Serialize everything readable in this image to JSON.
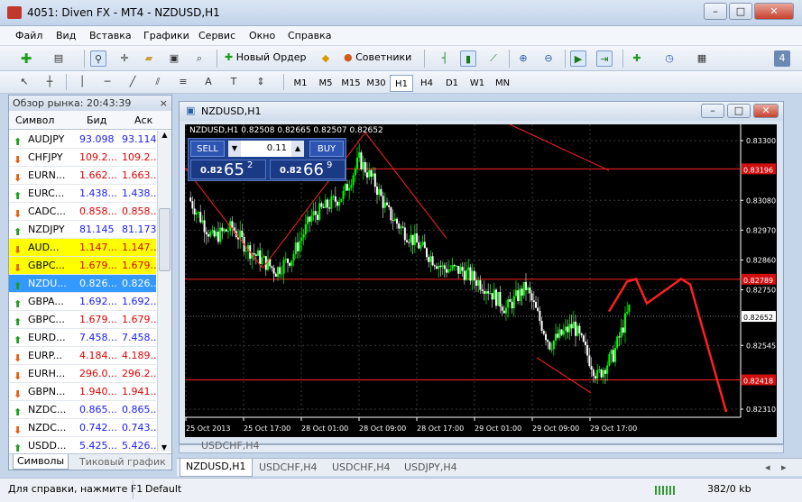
{
  "window": {
    "title": "4051: Diven FX - MT4 - NZDUSD,H1"
  },
  "menu": [
    "Файл",
    "Вид",
    "Вставка",
    "Графики",
    "Сервис",
    "Окно",
    "Справка"
  ],
  "toolbar": {
    "new_order": "Новый Ордер",
    "experts": "Советники"
  },
  "timeframes": [
    "M1",
    "M5",
    "M15",
    "M30",
    "H1",
    "H4",
    "D1",
    "W1",
    "MN"
  ],
  "active_timeframe": "H1",
  "market_watch": {
    "title": "Обзор рынка: 20:43:39",
    "col_symbol": "Символ",
    "col_bid": "Бид",
    "col_ask": "Аск",
    "rows": [
      {
        "symbol": "AUDJPY",
        "bid": "93.098",
        "ask": "93.114",
        "dir": "up",
        "price_color": "#1a1aff",
        "bg": ""
      },
      {
        "symbol": "CHFJPY",
        "bid": "109.2...",
        "ask": "109.2...",
        "dir": "down",
        "price_color": "#e00000",
        "bg": ""
      },
      {
        "symbol": "EURN...",
        "bid": "1.662...",
        "ask": "1.663...",
        "dir": "down",
        "price_color": "#e00000",
        "bg": ""
      },
      {
        "symbol": "EURC...",
        "bid": "1.438...",
        "ask": "1.438...",
        "dir": "up",
        "price_color": "#1a1aff",
        "bg": ""
      },
      {
        "symbol": "CADC...",
        "bid": "0.858...",
        "ask": "0.858...",
        "dir": "down",
        "price_color": "#e00000",
        "bg": ""
      },
      {
        "symbol": "NZDJPY",
        "bid": "81.145",
        "ask": "81.173",
        "dir": "up",
        "price_color": "#1a1aff",
        "bg": ""
      },
      {
        "symbol": "AUD...",
        "bid": "1.147...",
        "ask": "1.147...",
        "dir": "down",
        "price_color": "#e00000",
        "bg": "#ffff00"
      },
      {
        "symbol": "GBPC...",
        "bid": "1.679...",
        "ask": "1.679...",
        "dir": "down",
        "price_color": "#e00000",
        "bg": "#ffff00"
      },
      {
        "symbol": "NZDU...",
        "bid": "0.826...",
        "ask": "0.826...",
        "dir": "up",
        "price_color": "#ffffff",
        "bg": "#3399ff"
      },
      {
        "symbol": "GBPA...",
        "bid": "1.692...",
        "ask": "1.692...",
        "dir": "up",
        "price_color": "#1a1aff",
        "bg": ""
      },
      {
        "symbol": "GBPC...",
        "bid": "1.679...",
        "ask": "1.679...",
        "dir": "up",
        "price_color": "#e00000",
        "bg": ""
      },
      {
        "symbol": "EURD...",
        "bid": "7.458...",
        "ask": "7.458...",
        "dir": "up",
        "price_color": "#1a1aff",
        "bg": ""
      },
      {
        "symbol": "EURP...",
        "bid": "4.184...",
        "ask": "4.189...",
        "dir": "down",
        "price_color": "#e00000",
        "bg": ""
      },
      {
        "symbol": "EURH...",
        "bid": "296.0...",
        "ask": "296.2...",
        "dir": "down",
        "price_color": "#e00000",
        "bg": ""
      },
      {
        "symbol": "GBPN...",
        "bid": "1.940...",
        "ask": "1.941...",
        "dir": "down",
        "price_color": "#e00000",
        "bg": ""
      },
      {
        "symbol": "NZDC...",
        "bid": "0.865...",
        "ask": "0.865...",
        "dir": "up",
        "price_color": "#1a1aff",
        "bg": ""
      },
      {
        "symbol": "NZDC...",
        "bid": "0.742...",
        "ask": "0.743...",
        "dir": "down",
        "price_color": "#1a1aff",
        "bg": ""
      },
      {
        "symbol": "USDD...",
        "bid": "5.425...",
        "ask": "5.426...",
        "dir": "up",
        "price_color": "#1a1aff",
        "bg": ""
      }
    ],
    "tabs": [
      "Символы",
      "Тиковый график"
    ]
  },
  "chart_window": {
    "title": "NZDUSD,H1",
    "info": "NZDUSD,H1  0.82508 0.82665 0.82507 0.82652",
    "trade": {
      "sell": "SELL",
      "buy": "BUY",
      "lots": "0.11",
      "sell_small": "0.82",
      "sell_big": "65",
      "sell_sup": "2",
      "buy_small": "0.82",
      "buy_big": "66",
      "buy_sup": "9"
    },
    "price_labels": [
      "0.83300",
      "0.83080",
      "0.82970",
      "0.82860",
      "0.82750",
      "0.82545",
      "0.82310"
    ],
    "level_labels": [
      "0.83196",
      "0.82789",
      "0.82418"
    ],
    "current_price": "0.82652",
    "time_labels": [
      "25 Oct 2013",
      "25 Oct 17:00",
      "28 Oct 01:00",
      "28 Oct 09:00",
      "28 Oct 17:00",
      "29 Oct 01:00",
      "29 Oct 09:00",
      "29 Oct 17:00"
    ]
  },
  "second_window_title": "USDCHF,H4",
  "bottom_tabs": [
    "NZDUSD,H1",
    "USDCHF,H4",
    "USDCHF,H4",
    "USDJPY,H4"
  ],
  "status": {
    "help": "Для справки, нажмите F1",
    "profile": "Default",
    "traffic": "382/0 kb"
  },
  "colors": {
    "bull": "#00ff00",
    "bear": "#ffffff",
    "line": "#ff2020",
    "grid": "#3a3a3a"
  }
}
